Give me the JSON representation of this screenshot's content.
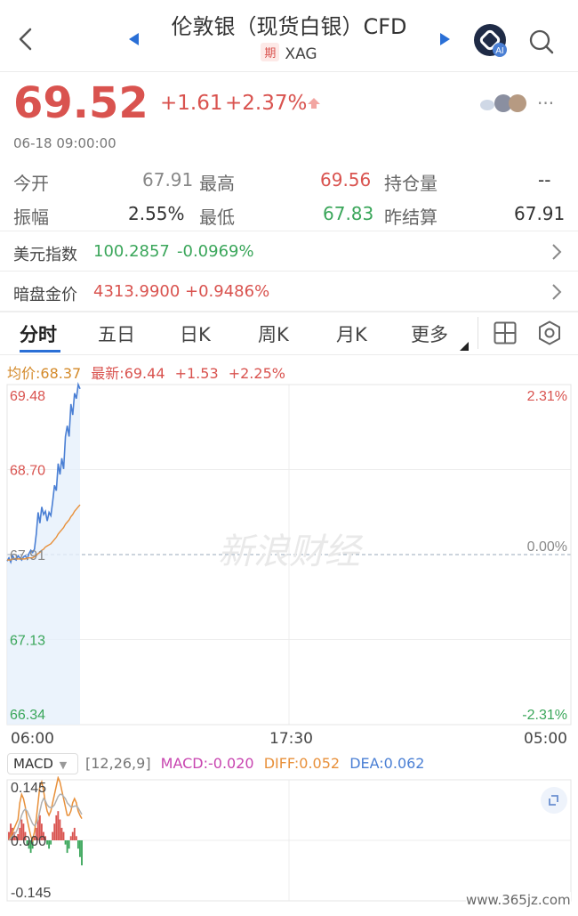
{
  "nav": {
    "title": "伦敦银（现货白银）CFD",
    "tag": "期",
    "symbol": "XAG"
  },
  "quote": {
    "price": "69.52",
    "change": "+1.61",
    "change_pct": "+2.37%",
    "time": "06-18 09:00:00"
  },
  "stats": {
    "open_label": "今开",
    "open": "67.91",
    "high_label": "最高",
    "high": "69.56",
    "oi_label": "持仓量",
    "oi": "--",
    "amp_label": "振幅",
    "amp": "2.55%",
    "low_label": "最低",
    "low": "67.83",
    "settle_label": "昨结算",
    "settle": "67.91"
  },
  "indices": [
    {
      "name": "美元指数",
      "value": "100.2857",
      "change": "-0.0969%"
    },
    {
      "name": "暗盘金价",
      "value": "4313.9900",
      "change": "+0.9486%"
    }
  ],
  "tabs": [
    "分时",
    "五日",
    "日K",
    "周K",
    "月K",
    "更多"
  ],
  "chart_info": {
    "avg": "均价:68.37",
    "latest": "最新:69.44",
    "chg": "+1.53",
    "chg_pct": "+2.25%"
  },
  "chart_data": [
    {
      "type": "line",
      "y_left_ticks": [
        "69.48",
        "68.70",
        "67.91",
        "67.13",
        "66.34"
      ],
      "y_right_ticks": [
        "2.31%",
        "0.00%",
        "-2.31%"
      ],
      "x_ticks": [
        "06:00",
        "17:30",
        "05:00"
      ],
      "ylim": [
        66.34,
        69.48
      ],
      "baseline": 67.91,
      "watermark": "新浪财经",
      "series": [
        {
          "values": [
            67.85,
            67.88,
            67.84,
            67.9,
            67.87,
            67.86,
            67.9,
            67.88,
            67.86,
            67.89,
            67.9,
            67.87,
            67.92,
            67.95,
            67.93,
            67.96,
            68.1,
            68.3,
            68.2,
            68.35,
            68.28,
            68.31,
            68.22,
            68.3,
            68.27,
            68.4,
            68.55,
            68.5,
            68.75,
            68.65,
            68.8,
            68.7,
            69.0,
            69.1,
            69.0,
            69.3,
            69.2,
            69.4,
            69.35,
            69.48,
            69.44
          ]
        },
        {
          "values": [
            67.86,
            67.86,
            67.86,
            67.87,
            67.87,
            67.87,
            67.87,
            67.87,
            67.87,
            67.87,
            67.87,
            67.88,
            67.88,
            67.88,
            67.88,
            67.89,
            67.9,
            67.92,
            67.93,
            67.95,
            67.96,
            67.98,
            67.99,
            68.0,
            68.01,
            68.03,
            68.05,
            68.07,
            68.1,
            68.12,
            68.14,
            68.16,
            68.19,
            68.21,
            68.23,
            68.26,
            68.28,
            68.31,
            68.33,
            68.35,
            68.37
          ]
        }
      ]
    },
    {
      "type": "bar",
      "title": "MACD",
      "params": "[12,26,9]",
      "macd_label": "MACD:-0.020",
      "diff_label": "DIFF:0.052",
      "dea_label": "DEA:0.062",
      "y_ticks": [
        "0.145",
        "0.000",
        "-0.145"
      ],
      "ylim": [
        -0.145,
        0.145
      ],
      "bars": [
        0.02,
        0.04,
        0.03,
        0.02,
        0.01,
        0.015,
        0.03,
        0.05,
        0.04,
        0.02,
        -0.01,
        -0.02,
        -0.03,
        -0.02,
        0.01,
        0.03,
        0.05,
        0.06,
        0.04,
        0.02,
        0.01,
        -0.01,
        -0.02,
        -0.01,
        0.02,
        0.04,
        0.06,
        0.07,
        0.05,
        0.03,
        0.02,
        -0.01,
        -0.03,
        -0.02,
        0.01,
        0.02,
        0.03,
        0.01,
        -0.02,
        -0.04,
        -0.06
      ],
      "series": [
        {
          "name": "DIFF",
          "values": [
            0.0,
            0.01,
            0.02,
            0.03,
            0.04,
            0.05,
            0.09,
            0.11,
            0.1,
            0.08,
            0.05,
            0.03,
            0.01,
            0.0,
            0.02,
            0.05,
            0.09,
            0.13,
            0.14,
            0.12,
            0.09,
            0.07,
            0.06,
            0.07,
            0.09,
            0.11,
            0.13,
            0.15,
            0.14,
            0.12,
            0.1,
            0.08,
            0.06,
            0.06,
            0.07,
            0.09,
            0.1,
            0.09,
            0.07,
            0.06,
            0.052
          ]
        },
        {
          "name": "DEA",
          "values": [
            0.0,
            0.005,
            0.01,
            0.015,
            0.02,
            0.03,
            0.045,
            0.06,
            0.07,
            0.075,
            0.07,
            0.06,
            0.05,
            0.04,
            0.035,
            0.04,
            0.05,
            0.07,
            0.09,
            0.1,
            0.095,
            0.085,
            0.08,
            0.078,
            0.08,
            0.085,
            0.095,
            0.105,
            0.11,
            0.11,
            0.105,
            0.1,
            0.09,
            0.085,
            0.08,
            0.08,
            0.082,
            0.082,
            0.078,
            0.07,
            0.062
          ]
        }
      ]
    }
  ],
  "footer": {
    "watermark": "www.365jz.com"
  },
  "colors": {
    "up": "#d9534f",
    "down": "#3aa65a",
    "price_line": "#4a7fd4",
    "avg_line": "#e8903a",
    "diff_line": "#e8903a",
    "dea_line": "#b0b0b0"
  }
}
